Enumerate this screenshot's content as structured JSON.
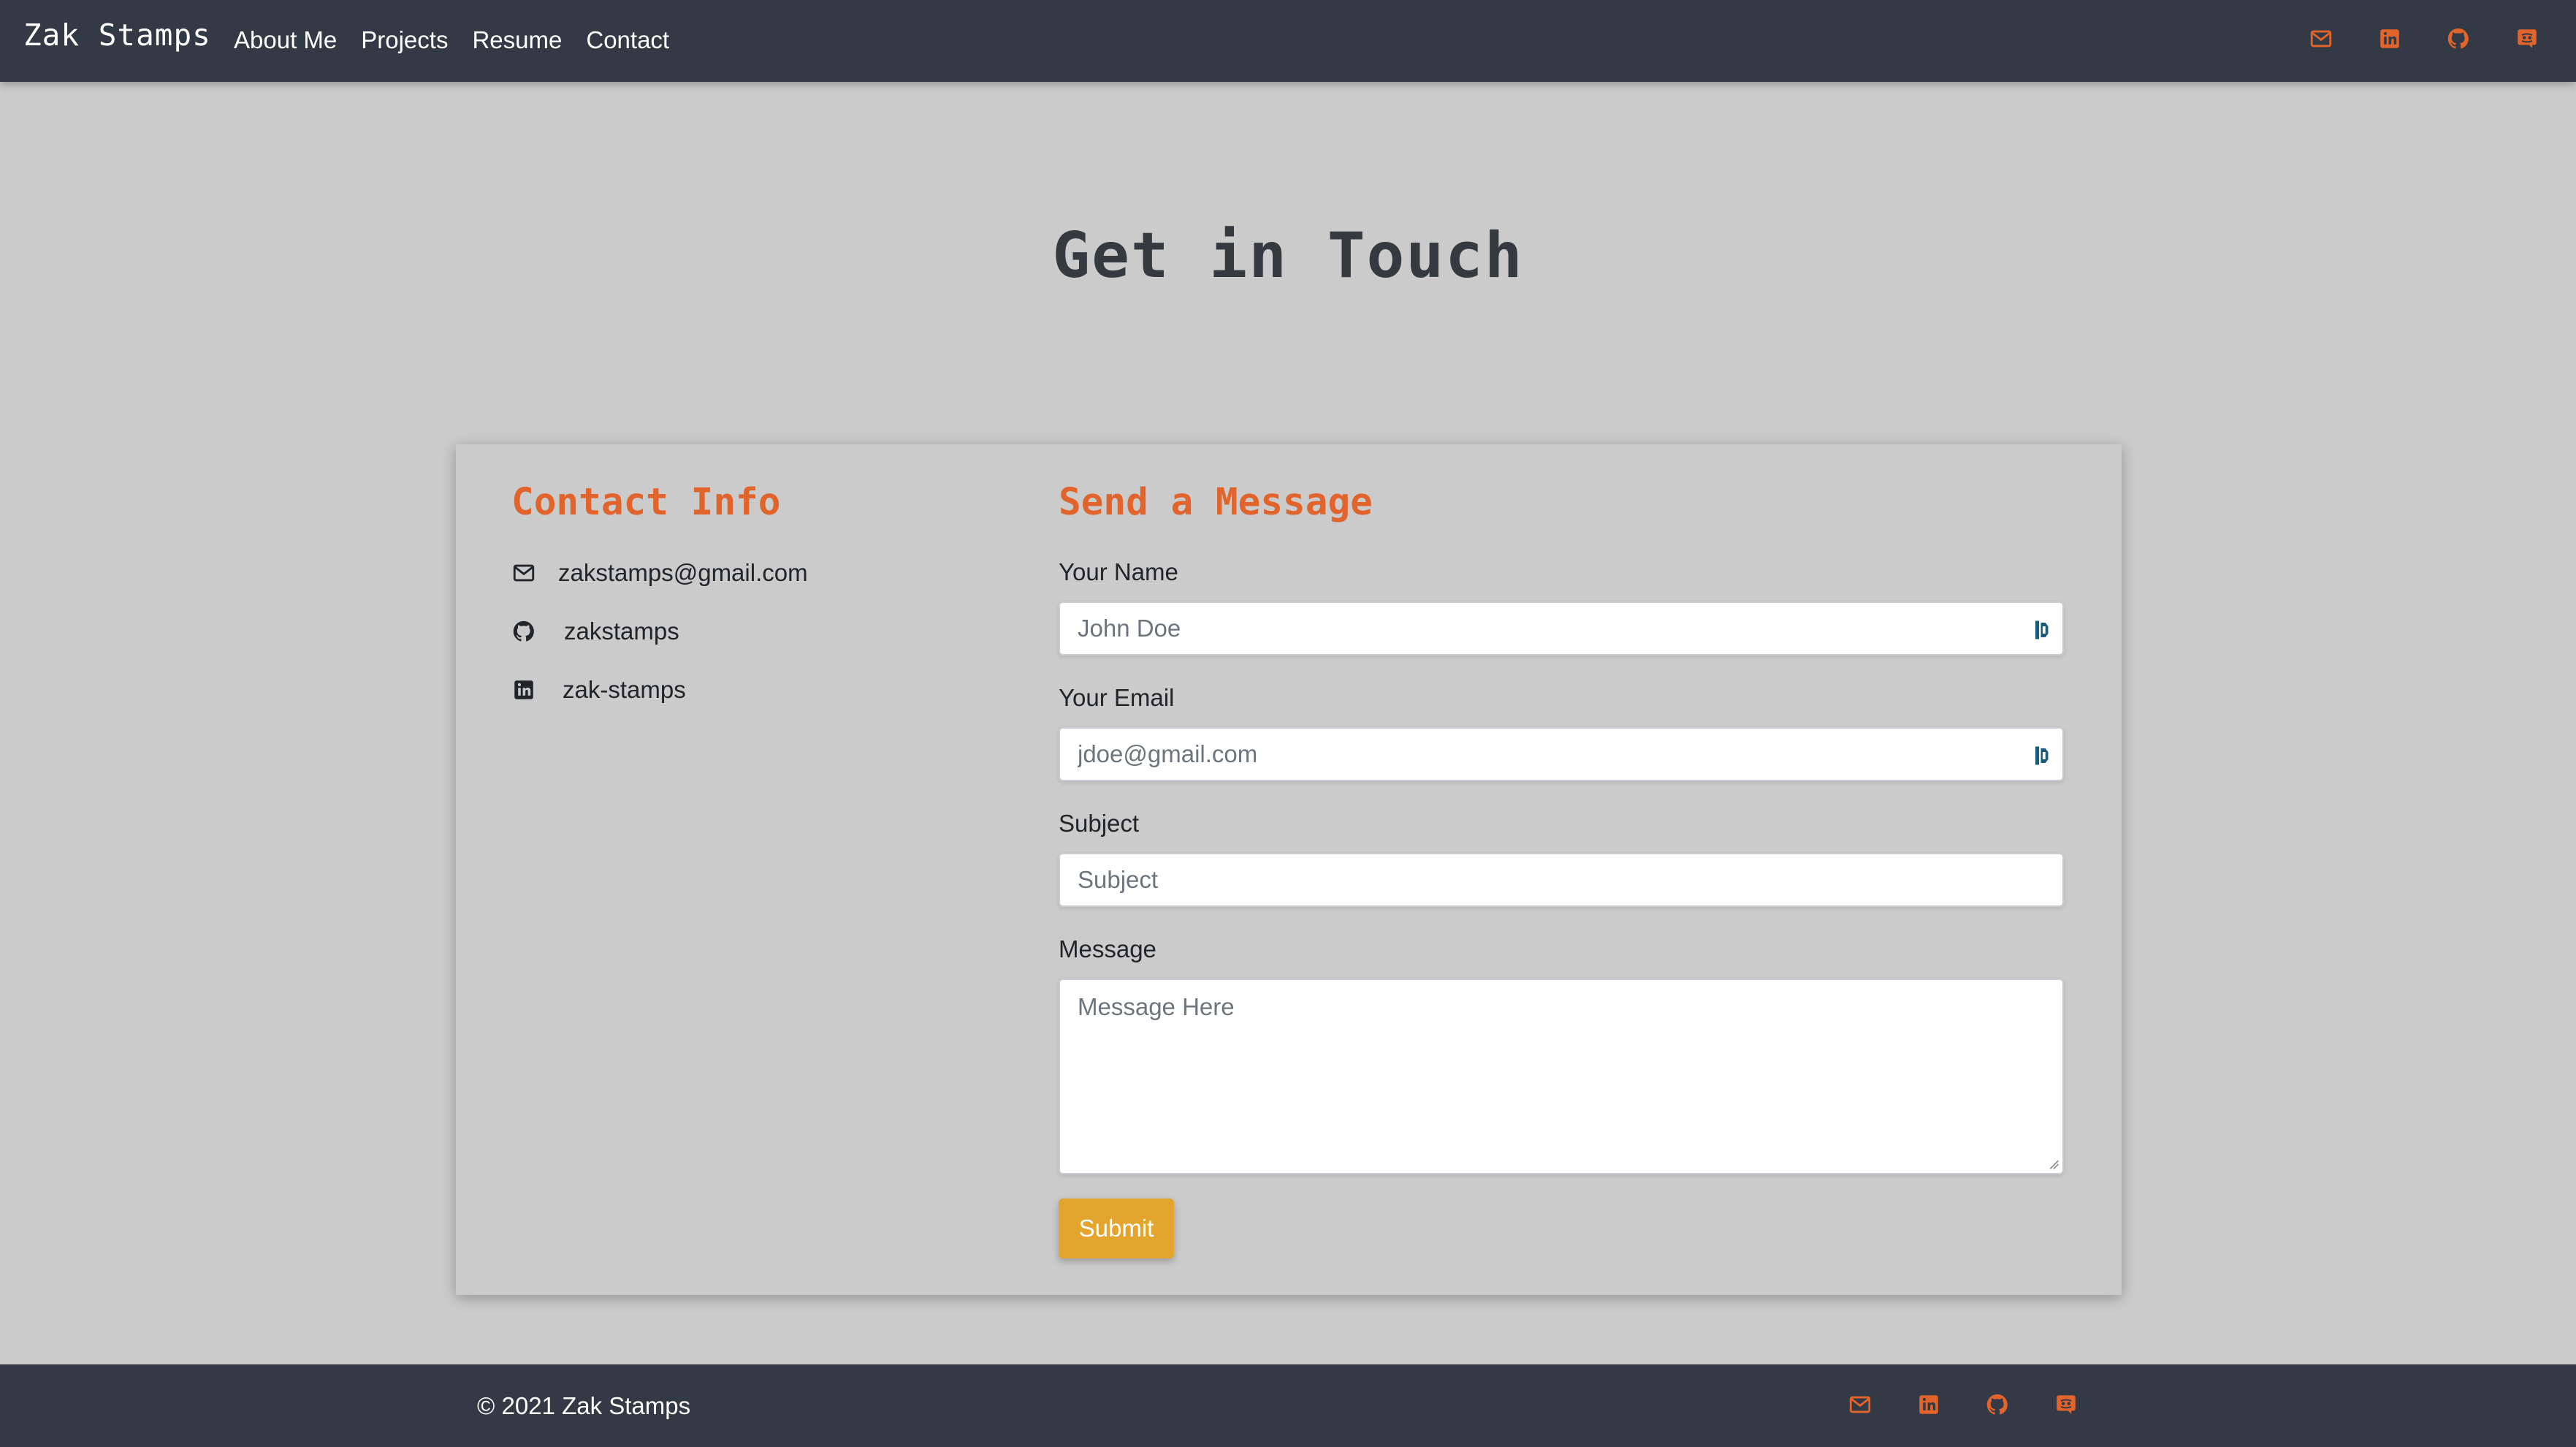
{
  "navbar": {
    "brand": "Zak Stamps",
    "links": [
      "About Me",
      "Projects",
      "Resume",
      "Contact"
    ],
    "icons": [
      "envelope-icon",
      "linkedin-icon",
      "github-icon",
      "discord-icon"
    ]
  },
  "page": {
    "title": "Get in Touch"
  },
  "contact_info": {
    "heading": "Contact Info",
    "items": [
      {
        "icon": "envelope-icon",
        "text": "zakstamps@gmail.com"
      },
      {
        "icon": "github-icon",
        "text": "zakstamps"
      },
      {
        "icon": "linkedin-icon",
        "text": "zak-stamps"
      }
    ]
  },
  "message_form": {
    "heading": "Send a Message",
    "name_label": "Your Name",
    "name_placeholder": "John Doe",
    "email_label": "Your Email",
    "email_placeholder": "jdoe@gmail.com",
    "subject_label": "Subject",
    "subject_placeholder": "Subject",
    "message_label": "Message",
    "message_placeholder": "Message Here",
    "submit_label": "Submit"
  },
  "footer": {
    "copyright": "© 2021 Zak Stamps",
    "icons": [
      "envelope-icon",
      "linkedin-icon",
      "github-icon",
      "discord-icon"
    ]
  },
  "colors": {
    "navbar_bg": "#343a45",
    "page_bg": "#cbcbcb",
    "accent_orange": "#e0642b",
    "submit_yellow": "#e3a52e"
  }
}
